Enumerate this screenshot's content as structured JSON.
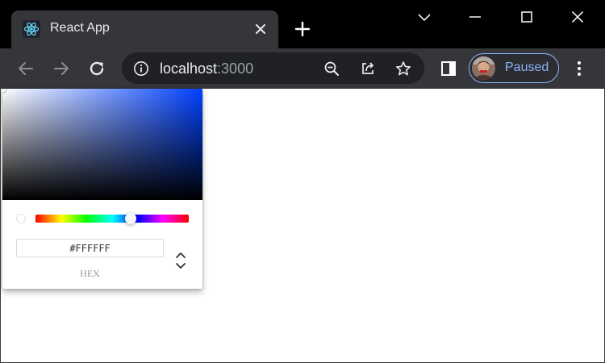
{
  "browser": {
    "tab": {
      "title": "React App"
    },
    "address_bar": {
      "host": "localhost",
      "port": ":3000"
    },
    "profile": {
      "label": "Paused"
    }
  },
  "color_picker": {
    "hex_value": "#FFFFFF",
    "mode_label": "HEX",
    "hue_position": 0.62,
    "colors": {
      "saturation_base": "#0040ff",
      "swatch": "#ffffff"
    }
  },
  "colors": {
    "titlebar": "#000000",
    "tab": "#35363a",
    "toolbar": "#35363a",
    "omnibox": "#202124",
    "accent": "#8ab4f8"
  },
  "icons": {
    "tab_favicon": "react-logo-icon",
    "tab_close": "close-icon",
    "new_tab": "plus-icon",
    "tab_search": "chevron-down-icon",
    "minimize": "minimize-icon",
    "maximize": "maximize-icon",
    "close_window": "close-icon",
    "back": "arrow-left-icon",
    "forward": "arrow-right-icon",
    "reload": "reload-icon",
    "site_info": "info-icon",
    "zoom": "zoom-out-icon",
    "share": "share-icon",
    "bookmark": "star-icon",
    "side_panel": "side-panel-icon",
    "menu": "more-vert-icon",
    "mode_toggle": "up-down-chevron-icon"
  }
}
